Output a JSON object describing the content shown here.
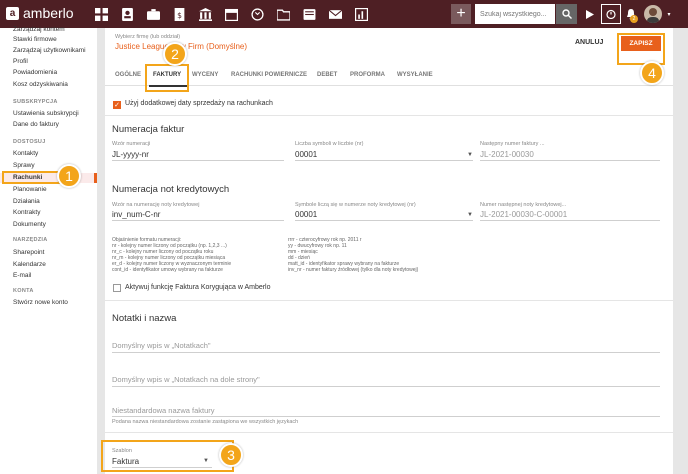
{
  "topbar": {
    "logo_text": "amberlo",
    "search_placeholder": "Szukaj wszystkiego...",
    "notification_count": "2"
  },
  "sidebar": {
    "items_top": [
      "Zarządzaj kontem",
      "Stawki firmowe",
      "Zarządzaj użytkownikami",
      "Profil",
      "Powiadomienia",
      "Kosz odzyskiwania"
    ],
    "subskrypcja_head": "SUBSKRYPCJA",
    "subskrypcja_items": [
      "Ustawienia subskrypcji",
      "Dane do faktury"
    ],
    "dostosuj_head": "DOSTOSUJ",
    "dostosuj_items": [
      "Kontakty",
      "Sprawy",
      "Rachunki",
      "Planowanie",
      "Działania",
      "Kontrakty",
      "Dokumenty"
    ],
    "narzedzia_head": "NARZĘDZIA",
    "narzedzia_items": [
      "Sharepoint",
      "Kalendarze",
      "E-mail"
    ],
    "konta_head": "KONTA",
    "konta_items": [
      "Stwórz nowe konto"
    ]
  },
  "header": {
    "firm_label": "Wybierz firmę (lub oddział)",
    "firm_value": "Justice League Law Firm (Domyślne)",
    "cancel_label": "ANULUJ",
    "save_label": "ZAPISZ"
  },
  "tabs": [
    "OGÓLNE",
    "FAKTURY",
    "WYCENY",
    "RACHUNKI POWIERNICZE",
    "DEBET",
    "PROFORMA",
    "WYSYŁANIE"
  ],
  "form": {
    "additional_date_label": "Użyj dodatkowej daty sprzedaży na rachunkach",
    "numeracja_title": "Numeracja faktur",
    "pattern_label": "Wzór numeracji",
    "pattern_value": "JL-yyyy-nr",
    "digits_label": "Liczba symboli w liczbie (nr)",
    "digits_value": "00001",
    "next_label": "Następny numer faktury ...",
    "next_value": "JL-2021-00030",
    "credit_title": "Numeracja not kredytowych",
    "credit_pattern_label": "Wzór na numerację noty kredytowej",
    "credit_pattern_value": "inv_num-C-nr",
    "credit_digits_label": "Symbole liczą się w numerze noty kredytowej (nr)",
    "credit_digits_value": "00001",
    "credit_next_label": "Numer następnej noty kredytowej...",
    "credit_next_value": "JL-2021-00030-C-00001",
    "help_left": [
      "Objaśnienie formatu numeracji:",
      "nr - kolejny numer liczony od początku (np. 1,2,3 ...)",
      "nr_c - kolejny numer liczony od początku roku",
      "nr_m - kolejny numer liczony od początku miesiąca",
      "er_d - kolejny numer liczony w wyznaczonym terminie",
      "cont_id - identyfikator umowy wybrany na fakturze"
    ],
    "help_right": [
      "rrrr - czterocyfrowy rok np. 2011 r",
      "yy - dwucyfrowy rok np. 11",
      "mm - miesiąc",
      "dd - dzień",
      "matt_id - identyfikator sprawy wybrany na fakturze",
      "inv_nr - numer faktury źródłowej (tylko dla noty kredytowej)"
    ],
    "correcting_label": "Aktywuj funkcję Faktura Korygująca w Amberlo",
    "notes_title": "Notatki i nazwa",
    "notes_placeholder": "Domyślny wpis w „Notatkach\"",
    "notes_bottom_placeholder": "Domyślny wpis w „Notatkach na dole strony\"",
    "custom_name_placeholder": "Niestandardowa nazwa faktury",
    "custom_name_hint": "Podana nazwa niestandardowa zostanie zastąpiona we wszystkich językach",
    "template_label": "Szablon",
    "template_value": "Faktura"
  },
  "callouts": [
    "1",
    "2",
    "3",
    "4"
  ],
  "colors": {
    "topbar": "#4e1f24",
    "accent": "#e8601c",
    "callout": "#f3a51a"
  }
}
